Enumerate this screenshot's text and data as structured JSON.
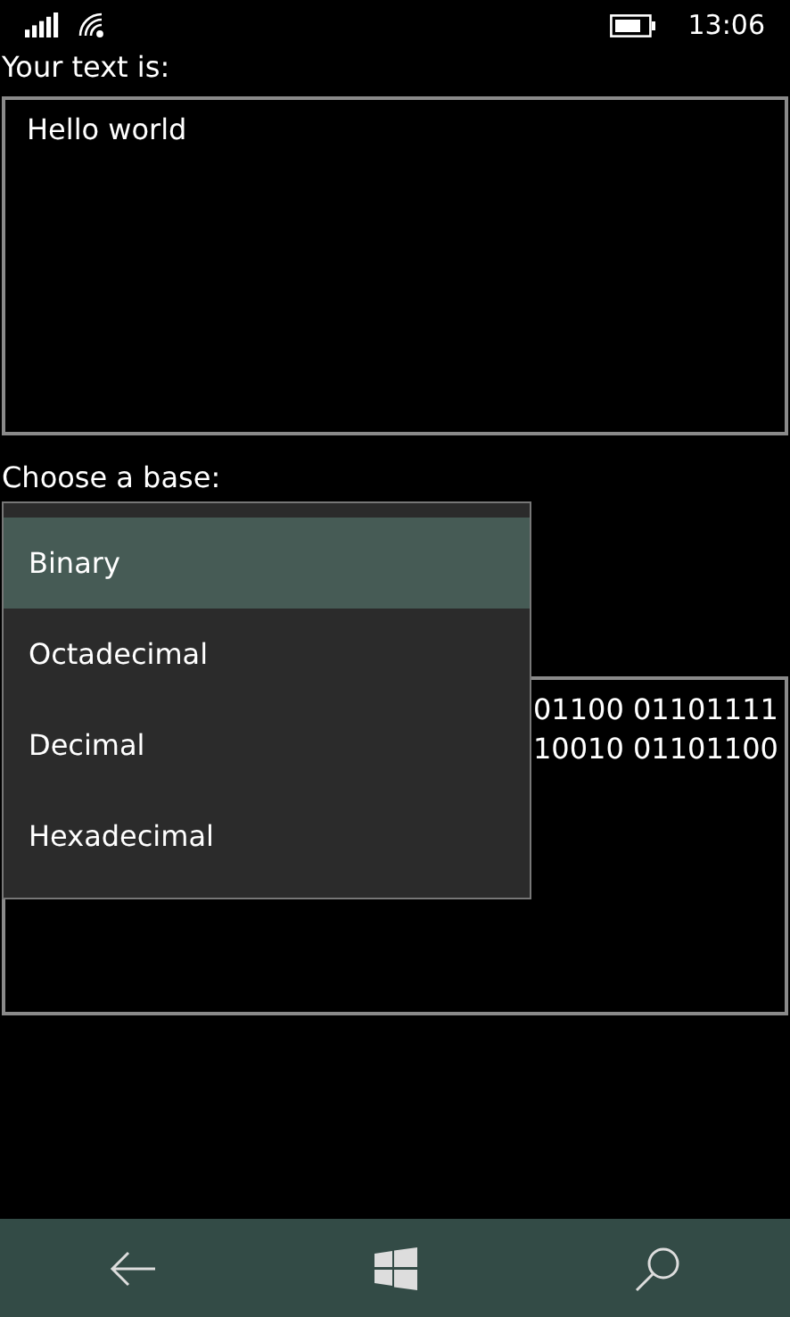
{
  "status_bar": {
    "time": "13:06"
  },
  "input": {
    "label": "Your text is:",
    "value": "Hello world"
  },
  "base": {
    "label": "Choose a base:"
  },
  "dropdown": {
    "items": [
      {
        "label": "Binary",
        "selected": true
      },
      {
        "label": "Octadecimal",
        "selected": false
      },
      {
        "label": "Decimal",
        "selected": false
      },
      {
        "label": "Hexadecimal",
        "selected": false
      }
    ]
  },
  "output": {
    "lines": [
      "01100 01101111",
      "10010 01101100"
    ]
  }
}
